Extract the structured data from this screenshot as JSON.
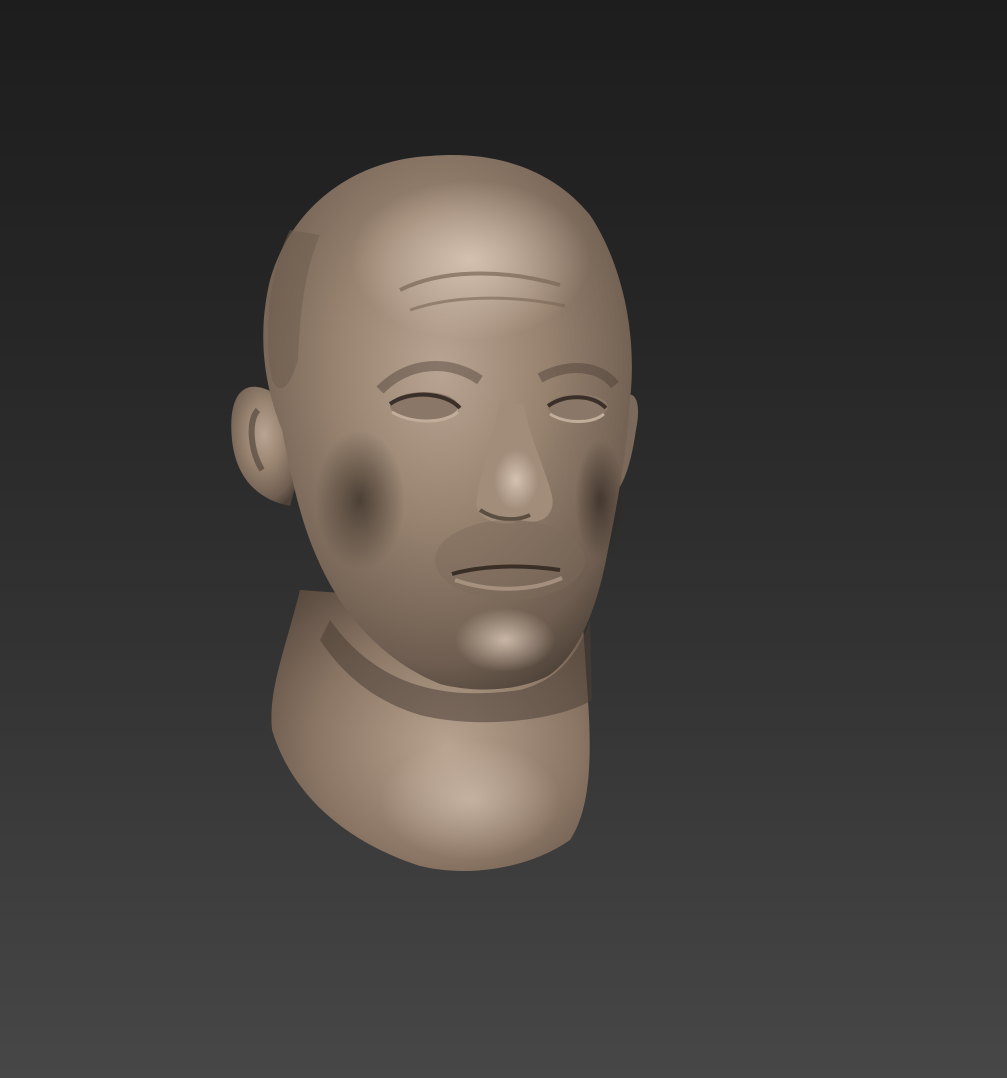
{
  "viewport": {
    "background_top": "#1d1d1d",
    "background_bottom": "#474747",
    "material_color": "#8e7b6d"
  },
  "model": {
    "icon": "sculpted-head-model"
  }
}
